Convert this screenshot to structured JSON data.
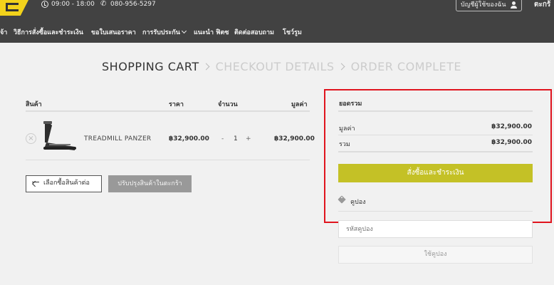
{
  "topbar": {
    "hours": "09:00 - 18:00",
    "phone": "080-956-5297",
    "account_label": "บัญชีผู้ใช้ของฉัน",
    "cart_label": "ตะกร้"
  },
  "nav": {
    "items": [
      {
        "label": "จ้า"
      },
      {
        "label": "วิธีการสั่งซื้อและชำระเงิน"
      },
      {
        "label": "ขอใบเสนอราคา"
      },
      {
        "label": "การรับประกัน"
      },
      {
        "label": "แนะนำ ฟิตซ"
      },
      {
        "label": "ติดต่อสอบถาม"
      },
      {
        "label": "โชว์รูม"
      }
    ]
  },
  "steps": {
    "cart": "SHOPPING CART",
    "checkout": "CHECKOUT DETAILS",
    "complete": "ORDER COMPLETE"
  },
  "cart_table": {
    "headers": {
      "product": "สินค้า",
      "price": "ราคา",
      "quantity": "จำนวน",
      "subtotal": "มูลค่า"
    },
    "rows": [
      {
        "remove": "×",
        "name": "TREADMILL PANZER",
        "price": "฿32,900.00",
        "qty": "1",
        "minus": "-",
        "plus": "+",
        "subtotal": "฿32,900.00"
      }
    ]
  },
  "actions": {
    "continue_label": "เลือกซื้อสินค้าต่อ",
    "update_label": "ปรับปรุงสินค้าในตะกร้า"
  },
  "totals": {
    "title": "ยอดรวม",
    "subtotal_label": "มูลค่า",
    "subtotal_value": "฿32,900.00",
    "total_label": "รวม",
    "total_value": "฿32,900.00",
    "checkout_label": "สั่งซื้อและชำระเงิน",
    "coupon_label": "คูปอง",
    "coupon_placeholder": "รหัสคูปอง",
    "coupon_button": "ใช้คูปอง"
  },
  "colors": {
    "topbar_bg": "#424242",
    "accent": "#c4c126",
    "logo": "#f2d21b",
    "highlight": "#e0141e"
  },
  "icons": [
    "clock-icon",
    "phone-icon",
    "user-icon",
    "chevron-down-icon",
    "remove-icon",
    "arrow-left-icon",
    "tag-icon"
  ]
}
